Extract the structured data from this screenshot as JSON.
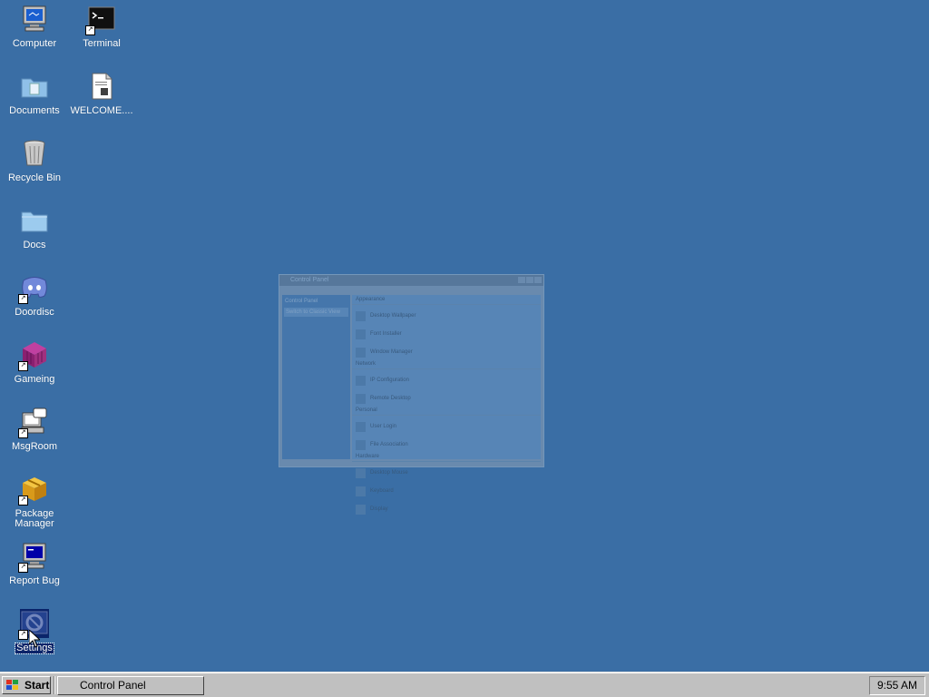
{
  "desktop": {
    "background": "#3a6ea5",
    "icons": [
      {
        "label": "Computer",
        "icon": "computer-icon",
        "shortcut": false
      },
      {
        "label": "Terminal",
        "icon": "terminal-icon",
        "shortcut": true
      },
      {
        "label": "Documents",
        "icon": "documents-folder-icon",
        "shortcut": false
      },
      {
        "label": "WELCOME....",
        "icon": "text-document-icon",
        "shortcut": false
      },
      {
        "label": "Recycle Bin",
        "icon": "recycle-bin-icon",
        "shortcut": false
      },
      {
        "label": "Docs",
        "icon": "folder-icon",
        "shortcut": false
      },
      {
        "label": "Doordisc",
        "icon": "doordisc-icon",
        "shortcut": true
      },
      {
        "label": "Gameing",
        "icon": "game-cube-icon",
        "shortcut": true
      },
      {
        "label": "MsgRoom",
        "icon": "msgroom-icon",
        "shortcut": true
      },
      {
        "label": "Package Manager",
        "icon": "package-icon",
        "shortcut": true
      },
      {
        "label": "Report Bug",
        "icon": "report-bug-icon",
        "shortcut": true
      },
      {
        "label": "Settings",
        "icon": "settings-icon",
        "shortcut": true,
        "selected": true
      }
    ]
  },
  "control_panel_window": {
    "title": "Control Panel",
    "state": "fading",
    "side_heading": "Control Panel",
    "side_item": "Switch to Classic View",
    "categories": [
      {
        "name": "Appearance",
        "items": [
          "Desktop Wallpaper",
          "Font Installer",
          "Window Manager"
        ]
      },
      {
        "name": "Network",
        "items": [
          "IP Configuration",
          "Remote Desktop"
        ]
      },
      {
        "name": "Personal",
        "items": [
          "User Login",
          "File Association"
        ]
      },
      {
        "name": "Hardware",
        "items": [
          "Desktop Mouse",
          "Keyboard",
          "Display"
        ]
      }
    ]
  },
  "taskbar": {
    "start_label": "Start",
    "tasks": [
      {
        "label": "Control Panel",
        "icon": "control-panel-icon"
      }
    ],
    "clock": "9:55 AM"
  }
}
